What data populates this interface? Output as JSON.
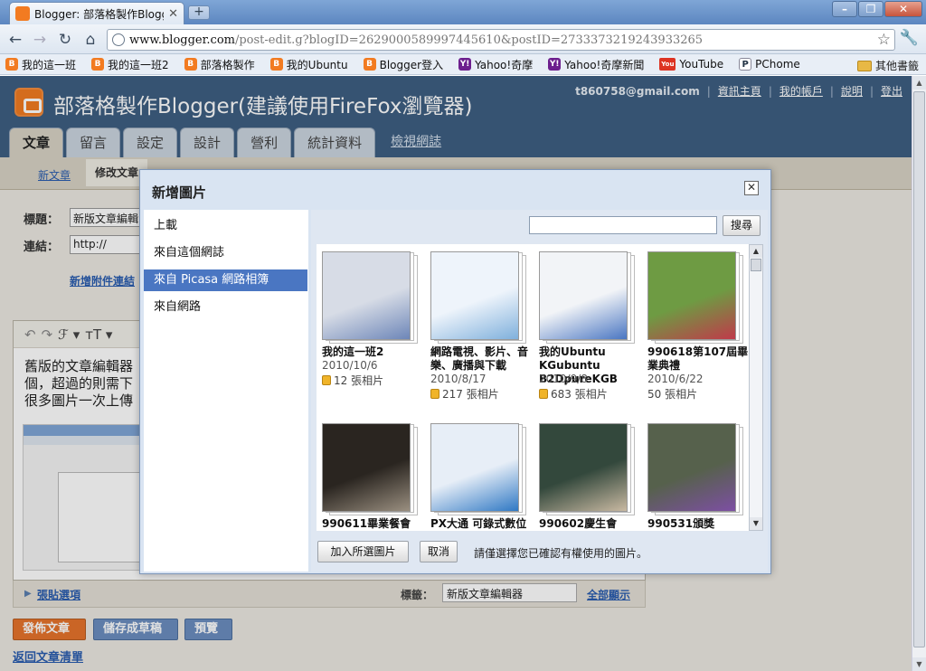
{
  "browser": {
    "tab_title": "Blogger: 部落格製作Blogg...",
    "url_host": "www.blogger.com",
    "url_path": "/post-edit.g?blogID=2629000589997445610&postID=2733373219243933265",
    "bookmarks": [
      {
        "label": "我的這一班",
        "icon": "blogger-icon"
      },
      {
        "label": "我的這一班2",
        "icon": "blogger-icon"
      },
      {
        "label": "部落格製作",
        "icon": "blogger-icon"
      },
      {
        "label": "我的Ubuntu",
        "icon": "blogger-icon"
      },
      {
        "label": "Blogger登入",
        "icon": "blogger-icon"
      },
      {
        "label": "Yahoo!奇摩",
        "icon": "yahoo-icon"
      },
      {
        "label": "Yahoo!奇摩新聞",
        "icon": "yahoo-icon"
      },
      {
        "label": "YouTube",
        "icon": "youtube-icon"
      },
      {
        "label": "PChome",
        "icon": "pchome-icon"
      }
    ],
    "other_bookmarks": "其他書籤"
  },
  "blogger": {
    "title": "部落格製作Blogger(建議使用FireFox瀏覽器)",
    "email": "t860758@gmail.com",
    "top_links": [
      "資訊主頁",
      "我的帳戶",
      "說明",
      "登出"
    ],
    "tabs": [
      "文章",
      "留言",
      "設定",
      "設計",
      "營利",
      "統計資料"
    ],
    "view_blog": "檢視網誌",
    "subnav": {
      "new_post": "新文章",
      "edit_post": "修改文章"
    },
    "form": {
      "title_label": "標題：",
      "title_value": "新版文章編輯",
      "link_label": "連結：",
      "link_value": "http://",
      "add_attachment": "新增附件連結"
    },
    "editor_lines": [
      "舊版的文章編輯器",
      "個，超過的則需下",
      "很多圖片一次上傳"
    ],
    "post_options": "張貼選項",
    "labels_label": "標籤：",
    "labels_value": "新版文章編輯器",
    "show_all": "全部顯示",
    "buttons": {
      "publish": "發佈文章",
      "save_draft": "儲存成草稿",
      "preview": "預覽"
    },
    "back_link": "返回文章清單"
  },
  "dialog": {
    "title": "新增圖片",
    "sources": [
      "上載",
      "來自這個網誌",
      "來自 Picasa 網路相簿",
      "來自網路"
    ],
    "active_source": 2,
    "search_button": "搜尋",
    "albums": [
      {
        "title": "我的這一班2",
        "date": "2010/10/6",
        "count": "12 張相片",
        "locked": true
      },
      {
        "title": "網路電視、影片、音樂、廣播與下載",
        "date": "2010/8/17",
        "count": "217 張相片",
        "locked": true
      },
      {
        "title": "我的Ubuntu KGubuntu B2DpureKGB",
        "date": "2010/9/8",
        "count": "683 張相片",
        "locked": true
      },
      {
        "title": "990618第107屆畢業典禮",
        "date": "2010/6/22",
        "count": "50 張相片",
        "locked": false
      },
      {
        "title": "990611畢業餐會",
        "date": "",
        "count": "",
        "locked": false
      },
      {
        "title": "PX大通 可錄式數位電視盒",
        "date": "",
        "count": "",
        "locked": false
      },
      {
        "title": "990602慶生會",
        "date": "",
        "count": "",
        "locked": false
      },
      {
        "title": "990531頒獎",
        "date": "",
        "count": "",
        "locked": false
      }
    ],
    "add_selected": "加入所選圖片",
    "cancel": "取消",
    "note": "請僅選擇您已確認有權使用的圖片。"
  }
}
